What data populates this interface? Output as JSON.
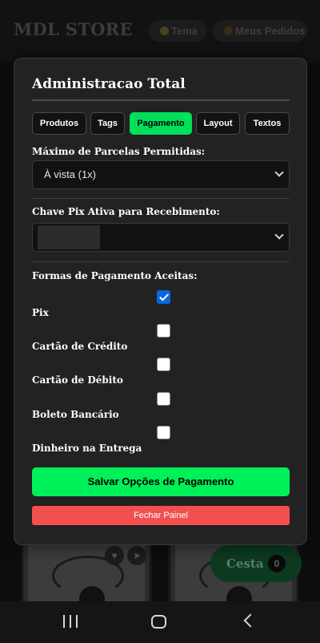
{
  "header": {
    "brand": "MDL STORE",
    "theme_label": "Tema",
    "orders_label": "Meus Pedidos"
  },
  "cart": {
    "label": "Cesta",
    "count": "0"
  },
  "admin": {
    "title": "Administracao Total",
    "tabs": [
      {
        "label": "Produtos",
        "active": false
      },
      {
        "label": "Tags",
        "active": false
      },
      {
        "label": "Pagamento",
        "active": true
      },
      {
        "label": "Layout",
        "active": false
      },
      {
        "label": "Textos",
        "active": false
      }
    ],
    "installments": {
      "label": "Máximo de Parcelas Permitidas:",
      "value": "À vista (1x)"
    },
    "pix_key": {
      "label": "Chave Pix Ativa para Recebimento:",
      "value": ""
    },
    "payment_methods": {
      "label": "Formas de Pagamento Aceitas:",
      "items": [
        {
          "label": "Pix",
          "checked": true
        },
        {
          "label": "Cartão de Crédito",
          "checked": false
        },
        {
          "label": "Cartão de Débito",
          "checked": false
        },
        {
          "label": "Boleto Bancário",
          "checked": false
        },
        {
          "label": "Dinheiro na Entrega",
          "checked": false
        }
      ]
    },
    "save_label": "Salvar Opções de Pagamento",
    "close_label": "Fechar Painel"
  },
  "colors": {
    "accent": "#00f05a",
    "danger": "#f25050",
    "checkbox_checked": "#0b66e4"
  }
}
